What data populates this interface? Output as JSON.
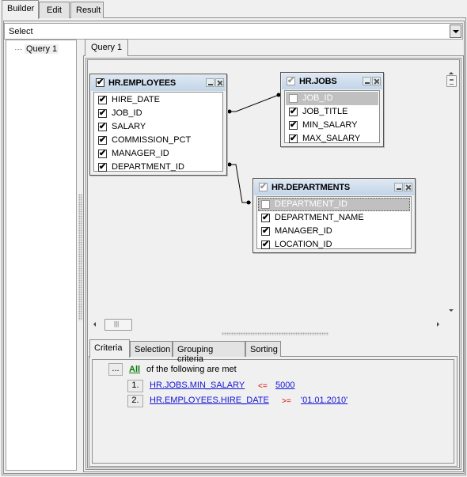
{
  "top_tabs": [
    {
      "label": "Builder",
      "active": true
    },
    {
      "label": "Edit",
      "active": false
    },
    {
      "label": "Result",
      "active": false
    }
  ],
  "query_type": {
    "value": "Select"
  },
  "tree": {
    "items": [
      {
        "label": "Query 1"
      }
    ]
  },
  "query_tabs": [
    {
      "label": "Query 1",
      "active": true
    }
  ],
  "diagram": {
    "tables": [
      {
        "name": "HR.EMPLOYEES",
        "checked": true,
        "fields": [
          {
            "name": "HIRE_DATE",
            "checked": true
          },
          {
            "name": "JOB_ID",
            "checked": true
          },
          {
            "name": "SALARY",
            "checked": true
          },
          {
            "name": "COMMISSION_PCT",
            "checked": true
          },
          {
            "name": "MANAGER_ID",
            "checked": true
          },
          {
            "name": "DEPARTMENT_ID",
            "checked": true
          }
        ]
      },
      {
        "name": "HR.JOBS",
        "checked": true,
        "fields": [
          {
            "name": "JOB_ID",
            "checked": false,
            "disabled": true
          },
          {
            "name": "JOB_TITLE",
            "checked": true
          },
          {
            "name": "MIN_SALARY",
            "checked": true
          },
          {
            "name": "MAX_SALARY",
            "checked": true
          }
        ]
      },
      {
        "name": "HR.DEPARTMENTS",
        "checked": true,
        "fields": [
          {
            "name": "DEPARTMENT_ID",
            "checked": false,
            "disabled": true
          },
          {
            "name": "DEPARTMENT_NAME",
            "checked": true
          },
          {
            "name": "MANAGER_ID",
            "checked": true
          },
          {
            "name": "LOCATION_ID",
            "checked": true
          }
        ]
      }
    ],
    "links": [
      {
        "from": "HR.EMPLOYEES.JOB_ID",
        "to": "HR.JOBS.JOB_ID"
      },
      {
        "from": "HR.EMPLOYEES.DEPARTMENT_ID",
        "to": "HR.DEPARTMENTS.DEPARTMENT_ID"
      }
    ]
  },
  "bottom_tabs": [
    {
      "label": "Criteria",
      "active": true
    },
    {
      "label": "Selection",
      "active": false
    },
    {
      "label": "Grouping criteria",
      "active": false
    },
    {
      "label": "Sorting",
      "active": false
    }
  ],
  "criteria": {
    "menu_button": "...",
    "quantifier": "All",
    "text": "of the following are met",
    "conditions": [
      {
        "index": "1.",
        "field": "HR.JOBS.MIN_SALARY",
        "operator": "<=",
        "value": "5000"
      },
      {
        "index": "2.",
        "field": "HR.EMPLOYEES.HIRE_DATE",
        "operator": ">=",
        "value": "'01.01.2010'"
      }
    ]
  }
}
